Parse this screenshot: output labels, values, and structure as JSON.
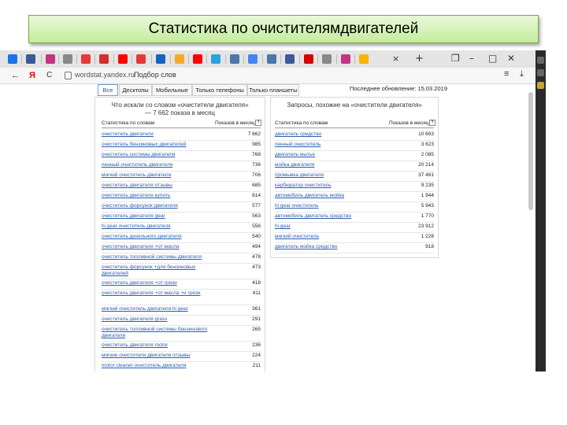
{
  "slide_title": "Статистика по очистителямдвигателей",
  "browser": {
    "address": "wordstat.yandex.ru",
    "page_title": "Подбор слов",
    "nav_back": "←",
    "yandex_logo": "Я",
    "reload": "C",
    "menu": "≡",
    "download": "⤓",
    "window_controls": {
      "restore": "❐",
      "minimize": "–",
      "maximize": "□",
      "close": "✕"
    },
    "tab_icons": [
      "yandex-browser-icon",
      "facebook-icon",
      "instagram-icon",
      "google-icon",
      "pdf-icon",
      "antivirus-icon",
      "yandex-icon",
      "chart-icon",
      "a-icon",
      "keep-icon",
      "youtube-icon",
      "telegram-icon",
      "vk-icon",
      "doc-icon",
      "vk-icon",
      "facebook-icon",
      "opera-icon",
      "google-icon",
      "instagram-icon",
      "slides-icon"
    ],
    "active_tab_close": "×",
    "new_tab": "+"
  },
  "filter_tabs": [
    "Все",
    "Десктопы",
    "Мобильные",
    "Только телефоны",
    "Только планшеты"
  ],
  "last_update": "Последнее обновление: 15.03.2019",
  "left_panel": {
    "heading": "Что искали со словом «очистители двигателя» — 7 662 показа в месяц",
    "col_keyword": "Статистика по словам",
    "col_count": "Показов в месяц",
    "rows": [
      {
        "kw": "очиститель двигателя",
        "n": "7 662"
      },
      {
        "kw": "очиститель бензиновых двигателей",
        "n": "985"
      },
      {
        "kw": "очиститель системы двигателя",
        "n": "768"
      },
      {
        "kw": "пенный очиститель двигателя",
        "n": "736"
      },
      {
        "kw": "мягкий очиститель двигателя",
        "n": "706"
      },
      {
        "kw": "очиститель двигателя отзывы",
        "n": "685"
      },
      {
        "kw": "очиститель двигателя купить",
        "n": "614"
      },
      {
        "kw": "очиститель форсунок двигателя",
        "n": "577"
      },
      {
        "kw": "очиститель двигателя gear",
        "n": "563"
      },
      {
        "kw": "hi gear очиститель двигателя",
        "n": "556"
      },
      {
        "kw": "очиститель дизельного двигателя",
        "n": "540"
      },
      {
        "kw": "очиститель двигателя +от масла",
        "n": "494"
      },
      {
        "kw": "очиститель топливной системы двигателя",
        "n": "478"
      },
      {
        "kw": "очиститель форсунок +для бензиновых двигателей",
        "n": "473"
      },
      {
        "kw": "очиститель двигателя +от грязи",
        "n": "418"
      },
      {
        "kw": "очиститель двигателя +от масла +и грязи",
        "n": "411"
      },
      {
        "kw": "мягкий очиститель двигателя hi gear",
        "n": "361"
      },
      {
        "kw": "очиститель двигателя grass",
        "n": "291"
      },
      {
        "kw": "очиститель топливной системы бензинового двигателя",
        "n": "265"
      },
      {
        "kw": "очиститель двигателя motor",
        "n": "236"
      },
      {
        "kw": "мягкие очистители двигателя отзывы",
        "n": "224"
      },
      {
        "kw": "motor cleaner очиститель двигателя",
        "n": "211"
      }
    ]
  },
  "right_panel": {
    "heading": "Запросы, похожие на «очистители двигателя»",
    "col_keyword": "Статистика по словам",
    "col_count": "Показов в месяц",
    "rows": [
      {
        "kw": "двигатель средство",
        "n": "10 693"
      },
      {
        "kw": "пенный очиститель",
        "n": "3 623"
      },
      {
        "kw": "двигатель мытье",
        "n": "2 085"
      },
      {
        "kw": "мойка двигателя",
        "n": "20 214"
      },
      {
        "kw": "промывка двигателя",
        "n": "37 481"
      },
      {
        "kw": "карбюратор очиститель",
        "n": "9 235"
      },
      {
        "kw": "автомобиль двигатель мойка",
        "n": "1 944"
      },
      {
        "kw": "hi gear очиститель",
        "n": "5 943"
      },
      {
        "kw": "автомобиль двигатель средство",
        "n": "1 770"
      },
      {
        "kw": "hi gear",
        "n": "23 912"
      },
      {
        "kw": "мягкий очиститель",
        "n": "1 228"
      },
      {
        "kw": "двигатель мойка средство",
        "n": "918"
      }
    ]
  },
  "colors": {
    "title_bg": "#d6f4b8",
    "link": "#2a5db0",
    "active_tab": "#1a4fb8"
  }
}
